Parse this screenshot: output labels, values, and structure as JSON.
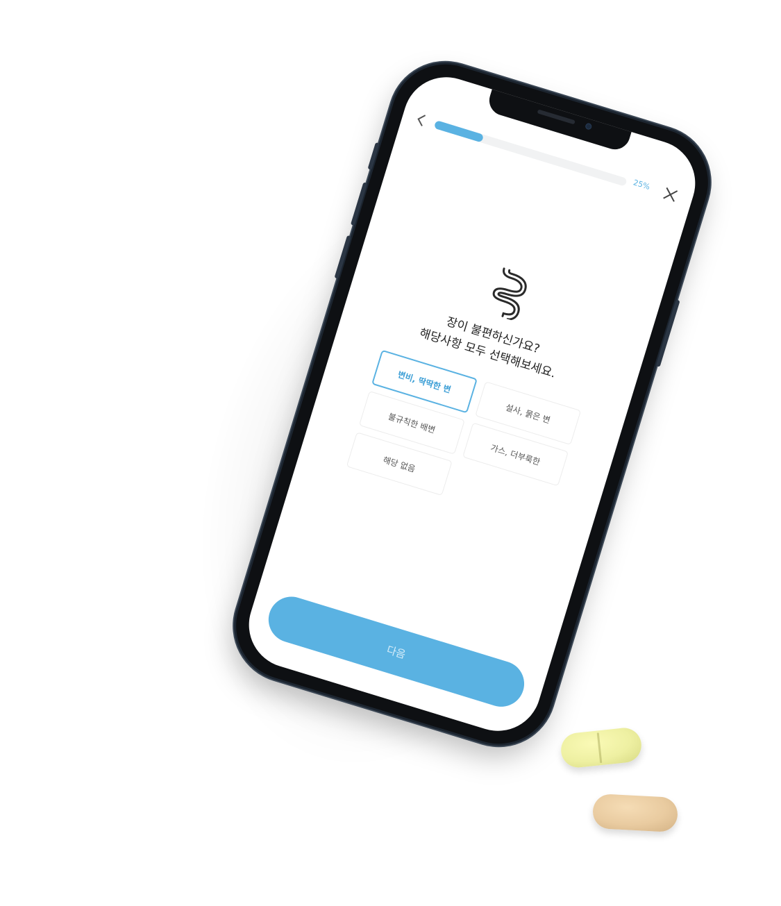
{
  "survey": {
    "progress_percent": 25,
    "progress_label": "25%",
    "question_line1": "장이 불편하신가요?",
    "question_line2": "해당사항 모두 선택해보세요.",
    "options": [
      {
        "label": "변비, 딱딱한 변",
        "selected": true
      },
      {
        "label": "설사, 묽은 변",
        "selected": false
      },
      {
        "label": "불규칙한 배변",
        "selected": false
      },
      {
        "label": "가스, 더부룩한",
        "selected": false
      },
      {
        "label": "해당 없음",
        "selected": false
      }
    ],
    "next_label": "다음"
  },
  "icons": {
    "back": "chevron-left-icon",
    "close": "close-icon",
    "question": "intestine-icon"
  },
  "colors": {
    "accent": "#5ab2e2",
    "pill_yellow": "#eef0a2",
    "pill_tan": "#e9cba0"
  }
}
